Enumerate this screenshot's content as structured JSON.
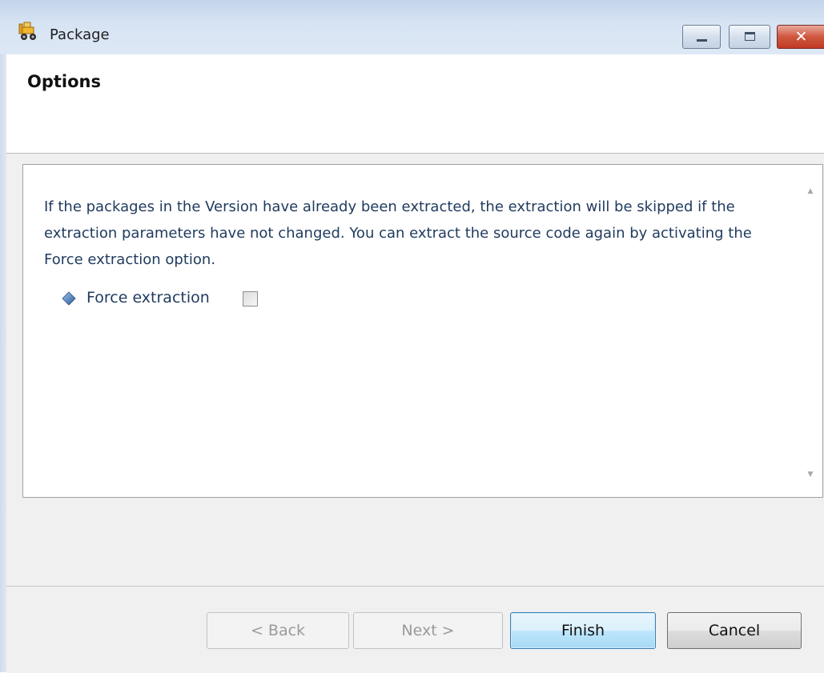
{
  "window": {
    "title": "Package",
    "icon": "forklift-icon",
    "controls": {
      "minimize": "minimize-icon",
      "maximize": "maximize-icon",
      "close": "close-icon"
    }
  },
  "header": {
    "title": "Options"
  },
  "content": {
    "description": "If the packages in the Version have already been extracted, the extraction will be skipped if the extraction parameters have not changed. You can extract the source code again by activating the Force extraction option.",
    "option": {
      "icon": "diamond-icon",
      "label": "Force extraction",
      "checked": false
    }
  },
  "buttons": {
    "back": "< Back",
    "next": "Next >",
    "finish": "Finish",
    "cancel": "Cancel"
  },
  "colors": {
    "text_blue": "#1f3a5e",
    "titlebar": "#d7e4f3",
    "close_button": "#c23a25",
    "default_button_border": "#3c7fb1"
  }
}
